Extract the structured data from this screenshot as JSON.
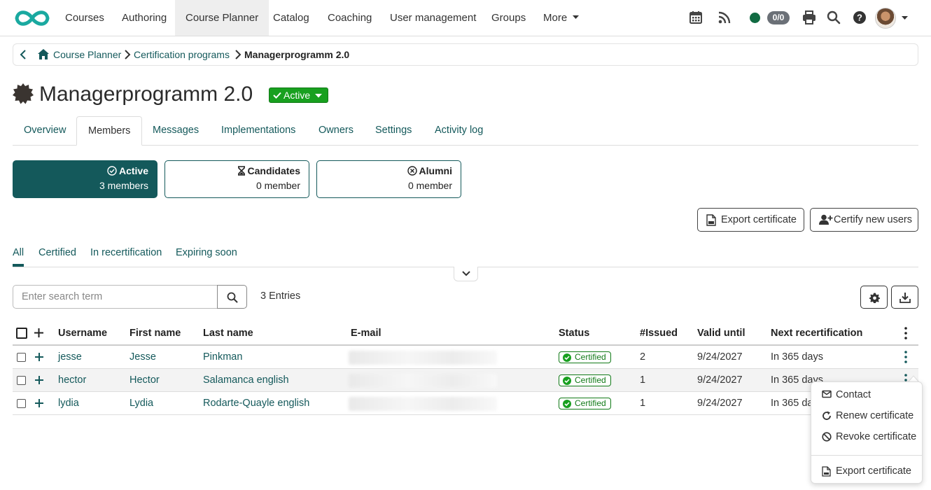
{
  "nav": {
    "items": [
      "Courses",
      "Authoring",
      "Course Planner",
      "Catalog",
      "Coaching",
      "User management",
      "Groups",
      "More"
    ],
    "active": "Course Planner",
    "counter": "0/0"
  },
  "breadcrumb": {
    "items": [
      "Course Planner",
      "Certification programs"
    ],
    "current": "Managerprogramm 2.0"
  },
  "page": {
    "title": "Managerprogramm 2.0",
    "status": "Active"
  },
  "tabs": [
    "Overview",
    "Members",
    "Messages",
    "Implementations",
    "Owners",
    "Settings",
    "Activity log"
  ],
  "active_tab": "Members",
  "member_cards": [
    {
      "title": "Active",
      "count": "3 members",
      "icon": "check-circle-icon"
    },
    {
      "title": "Candidates",
      "count": "0 member",
      "icon": "hourglass-icon"
    },
    {
      "title": "Alumni",
      "count": "0 member",
      "icon": "x-circle-icon"
    }
  ],
  "actions": {
    "export_certificate": "Export certificate",
    "certify_new_users": "Certify new users"
  },
  "filter_tabs": [
    "All",
    "Certified",
    "In recertification",
    "Expiring soon"
  ],
  "active_filter": "All",
  "search": {
    "placeholder": "Enter search term",
    "entries": "3 Entries"
  },
  "table": {
    "columns": [
      "Username",
      "First name",
      "Last name",
      "E-mail",
      "Status",
      "#Issued",
      "Valid until",
      "Next recertification"
    ],
    "rows": [
      {
        "username": "jesse",
        "first": "Jesse",
        "last": "Pinkman",
        "status": "Certified",
        "issued": "2",
        "valid": "9/24/2027",
        "next": "In 365 days"
      },
      {
        "username": "hector",
        "first": "Hector",
        "last": "Salamanca english",
        "status": "Certified",
        "issued": "1",
        "valid": "9/24/2027",
        "next": "In 365 days"
      },
      {
        "username": "lydia",
        "first": "Lydia",
        "last": "Rodarte-Quayle english",
        "status": "Certified",
        "issued": "1",
        "valid": "9/24/2027",
        "next": "In 365 days"
      }
    ]
  },
  "row_menu": {
    "items": [
      "Contact",
      "Renew certificate",
      "Revoke certificate",
      "Export certificate"
    ]
  },
  "colors": {
    "primary": "#14595b",
    "success": "#18a01f",
    "status_dot": "#116b43"
  }
}
